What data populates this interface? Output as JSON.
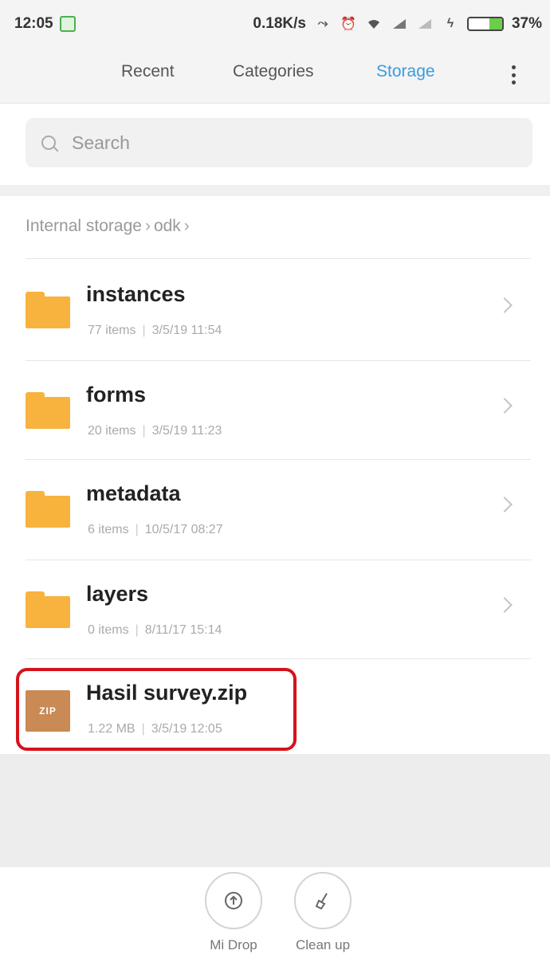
{
  "status_bar": {
    "time": "12:05",
    "net_speed": "0.18K/s",
    "battery_percent": "37%",
    "battery_level": 0.37
  },
  "tabs": [
    {
      "label": "Recent",
      "active": false
    },
    {
      "label": "Categories",
      "active": false
    },
    {
      "label": "Storage",
      "active": true
    }
  ],
  "search": {
    "placeholder": "Search"
  },
  "breadcrumb": [
    "Internal storage",
    "odk"
  ],
  "items": [
    {
      "name": "instances",
      "count": "77 items",
      "date": "3/5/19 11:54",
      "type": "folder"
    },
    {
      "name": "forms",
      "count": "20 items",
      "date": "3/5/19 11:23",
      "type": "folder"
    },
    {
      "name": "metadata",
      "count": "6 items",
      "date": "10/5/17 08:27",
      "type": "folder"
    },
    {
      "name": "layers",
      "count": "0 items",
      "date": "8/11/17 15:14",
      "type": "folder"
    },
    {
      "name": "Hasil survey.zip",
      "size": "1.22 MB",
      "date": "3/5/19 12:05",
      "type": "zip",
      "icon_text": "ZIP"
    }
  ],
  "bottom_actions": [
    {
      "label": "Mi Drop",
      "icon": "upload-icon"
    },
    {
      "label": "Clean up",
      "icon": "brush-icon"
    }
  ],
  "colors": {
    "accent": "#3a9bde",
    "folder": "#f8b23e",
    "zip": "#c98a55",
    "highlight": "#d4131a"
  }
}
